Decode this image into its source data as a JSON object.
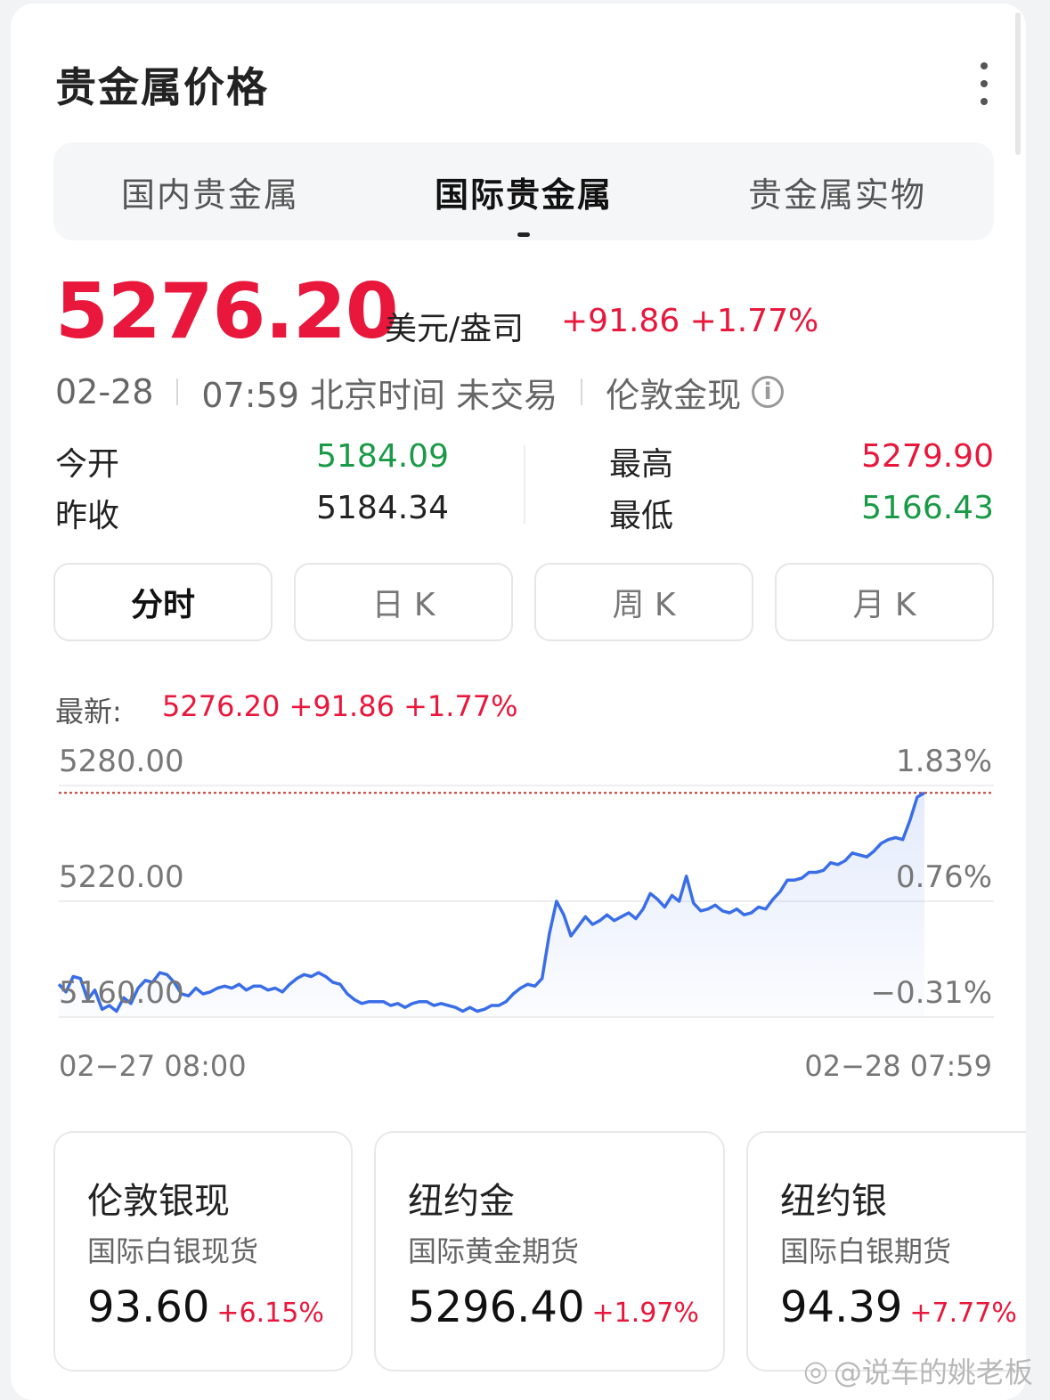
{
  "header": {
    "title": "贵金属价格"
  },
  "tabs": [
    {
      "label": "国内贵金属",
      "active": false
    },
    {
      "label": "国际贵金属",
      "active": true
    },
    {
      "label": "贵金属实物",
      "active": false
    }
  ],
  "quote": {
    "price": "5276.20",
    "unit": "美元/盎司",
    "change": "+91.86 +1.77%",
    "date": "02-28",
    "time_status": "07:59 北京时间 未交易",
    "instrument": "伦敦金现",
    "info_icon": "i"
  },
  "stats": {
    "open_label": "今开",
    "open_value": "5184.09",
    "prev_close_label": "昨收",
    "prev_close_value": "5184.34",
    "high_label": "最高",
    "high_value": "5279.90",
    "low_label": "最低",
    "low_value": "5166.43"
  },
  "periods": [
    {
      "label": "分时",
      "active": true
    },
    {
      "label": "日 K",
      "active": false
    },
    {
      "label": "周 K",
      "active": false
    },
    {
      "label": "月 K",
      "active": false
    }
  ],
  "latest": {
    "label": "最新:",
    "value": "5276.20 +91.86 +1.77%"
  },
  "chart_data": {
    "type": "area",
    "y_left_ticks": [
      "5280.00",
      "5220.00",
      "5160.00"
    ],
    "y_right_ticks": [
      "1.83%",
      "0.76%",
      "−0.31%"
    ],
    "ylim": [
      5160,
      5280
    ],
    "reference_value": 5276.2,
    "x_labels": [
      "02−27 08:00",
      "02−28 07:59"
    ],
    "series": [
      {
        "values": [
          5177,
          5173,
          5181,
          5180,
          5169,
          5174,
          5164,
          5166,
          5163,
          5170,
          5167,
          5175,
          5179,
          5178,
          5183,
          5182,
          5178,
          5172,
          5171,
          5175,
          5172,
          5173,
          5175,
          5176,
          5175,
          5177,
          5174,
          5176,
          5176,
          5174,
          5175,
          5173,
          5177,
          5180,
          5182,
          5181,
          5183,
          5181,
          5178,
          5177,
          5172,
          5169,
          5167,
          5168,
          5168,
          5168,
          5166,
          5167,
          5165,
          5167,
          5168,
          5168,
          5166,
          5167,
          5166,
          5165,
          5163,
          5165,
          5163,
          5164,
          5166,
          5166,
          5168,
          5172,
          5175,
          5177,
          5176,
          5180,
          5203,
          5220,
          5213,
          5202,
          5207,
          5212,
          5208,
          5210,
          5213,
          5210,
          5212,
          5214,
          5211,
          5216,
          5224,
          5221,
          5217,
          5223,
          5220,
          5233,
          5219,
          5215,
          5216,
          5218,
          5215,
          5214,
          5216,
          5213,
          5214,
          5217,
          5216,
          5221,
          5225,
          5231,
          5231,
          5232,
          5235,
          5235,
          5236,
          5240,
          5239,
          5241,
          5245,
          5244,
          5243,
          5246,
          5250,
          5252,
          5253,
          5252,
          5262,
          5274,
          5276.2
        ]
      }
    ]
  },
  "markets": [
    {
      "name": "伦敦银现",
      "desc": "国际白银现货",
      "price": "93.60",
      "change": "+6.15%"
    },
    {
      "name": "纽约金",
      "desc": "国际黄金期货",
      "price": "5296.40",
      "change": "+1.97%"
    },
    {
      "name": "纽约银",
      "desc": "国际白银期货",
      "price": "94.39",
      "change": "+7.77%"
    }
  ],
  "watermark": {
    "text": "@说车的姚老板"
  },
  "colors": {
    "up": "#e8173b",
    "down": "#1a9a46",
    "line": "#3a6ee8"
  }
}
